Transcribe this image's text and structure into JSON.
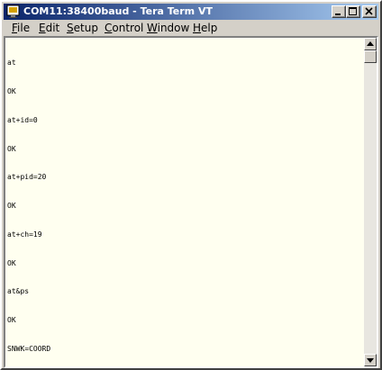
{
  "window": {
    "title": "COM11:38400baud - Tera Term VT",
    "icon": "tera-term-app-icon",
    "controls": [
      "minimize-icon",
      "maximize-icon",
      "close-icon"
    ]
  },
  "menu": [
    {
      "accel": "F",
      "rest": "ile"
    },
    {
      "accel": "E",
      "rest": "dit"
    },
    {
      "accel": "S",
      "rest": "etup"
    },
    {
      "accel": "C",
      "rest": "ontrol"
    },
    {
      "accel": "W",
      "rest": "indow"
    },
    {
      "accel": "H",
      "rest": "elp"
    }
  ],
  "terminal": {
    "lines": [
      "at",
      "OK",
      "at+id=0",
      "OK",
      "at+pid=20",
      "OK",
      "at+ch=19",
      "OK",
      "at&ps",
      "OK",
      "SNWK=COORD"
    ],
    "background_color": "#fffff0",
    "text_color": "#000000"
  },
  "scrollbar": {
    "position": 0
  }
}
